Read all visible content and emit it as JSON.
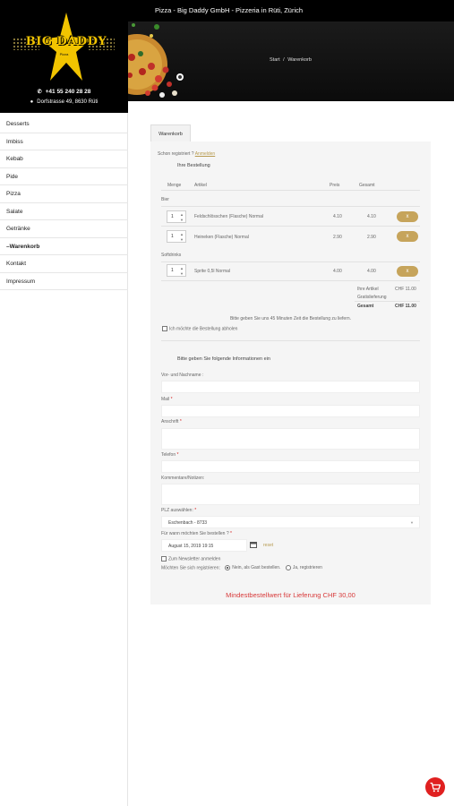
{
  "header": {
    "title": "Pizza - Big Daddy GmbH - Pizzeria in Rüti, Zürich"
  },
  "logo": {
    "text": "BIG DADDY",
    "subtext": "Pizza"
  },
  "contact": {
    "phone": "+41 55 240 28 28",
    "address": "Dorfstrasse 49, 8630 Rüti"
  },
  "nav": {
    "items": [
      {
        "label": "Desserts"
      },
      {
        "label": "Imbiss"
      },
      {
        "label": "Kebab"
      },
      {
        "label": "Pide"
      },
      {
        "label": "Pizza"
      },
      {
        "label": "Salate"
      },
      {
        "label": "Getränke"
      },
      {
        "label": "–Warenkorb"
      },
      {
        "label": "Kontakt"
      },
      {
        "label": "Impressum"
      }
    ]
  },
  "breadcrumb": {
    "home": "Start",
    "sep": "/",
    "current": "Warenkorb"
  },
  "tab": {
    "label": "Warenkorb"
  },
  "order": {
    "registered_prefix": "Schon registriert ?",
    "login_link": "Anmelden",
    "heading": "Ihre Bestellung",
    "columns": {
      "qty": "Menge",
      "article": "Artikel",
      "price": "Preis",
      "total": "Gesamt"
    },
    "groups": [
      {
        "name": "Bier",
        "items": [
          {
            "qty": "1",
            "article": "Feldschlösschen (Flasche) Normal",
            "price": "4.10",
            "total": "4.10",
            "remove": "x"
          },
          {
            "qty": "1",
            "article": "Heineken (Flasche) Normal",
            "price": "2.90",
            "total": "2.90",
            "remove": "x"
          }
        ]
      },
      {
        "name": "Softdrinks",
        "items": [
          {
            "qty": "1",
            "article": "Sprite 0,5l Normal",
            "price": "4.00",
            "total": "4.00",
            "remove": "x"
          }
        ]
      }
    ],
    "summary": {
      "articles_label": "Ihre Artikel",
      "articles_value": "CHF 11.00",
      "delivery_label": "Gratislieferung",
      "delivery_value": "",
      "total_label": "Gesamt",
      "total_value": "CHF 11.00"
    },
    "note": "Bitte geben Sie uns 45 Minuten Zeit die Bestellung zu liefern.",
    "pickup_label": "Ich möchte die Bestellung abholen"
  },
  "form": {
    "heading": "Bitte geben Sie folgende Informationen ein",
    "name_label": "Vor- und Nachname :",
    "mail_label": "Mail",
    "address_label": "Anschrift",
    "phone_label": "Telefon",
    "comment_label": "Kommentare/Notizen:",
    "plz_label": "PLZ auswählen:",
    "plz_value": "Eschenbach - 8733",
    "when_label": "Für wann möchten Sie bestellen ?",
    "date_value": "August 15, 2019 19:15",
    "reset_label": "reset",
    "newsletter_label": "Zum Newsletter anmelden",
    "register_question": "Möchten Sie sich registrieren:",
    "register_no": "Nein, als Gast bestellen.",
    "register_yes": "Ja, registrieren",
    "required_mark": "*"
  },
  "min_order": "Mindestbestellwert für Lieferung CHF 30,00",
  "colors": {
    "accent": "#c6a45b",
    "error": "#d83a3a",
    "header": "#000000"
  }
}
